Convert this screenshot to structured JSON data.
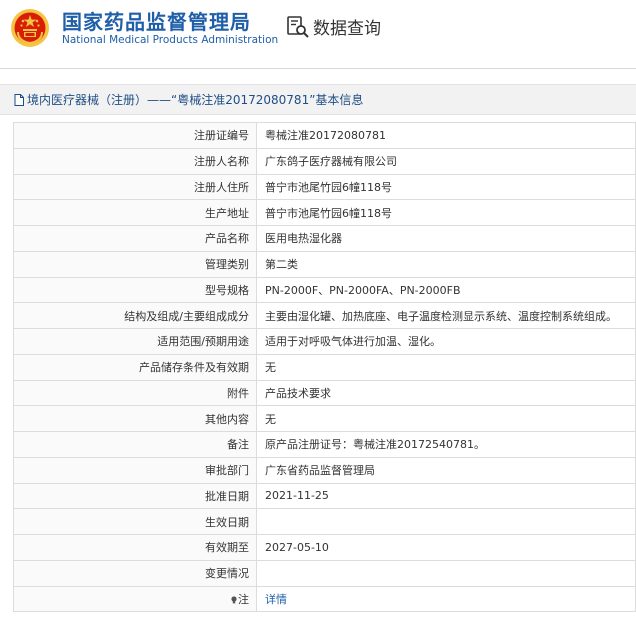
{
  "header": {
    "title_cn": "国家药品监督管理局",
    "title_en": "National Medical Products Administration",
    "query_label": "数据查询",
    "query_icon": "search-document-icon",
    "emblem_icon": "national-emblem-icon"
  },
  "breadcrumb": {
    "text": "境内医疗器械（注册）——“粤械注准20172080781”基本信息"
  },
  "rows": [
    {
      "label": "注册证编号",
      "value": "粤械注准20172080781"
    },
    {
      "label": "注册人名称",
      "value": "广东鸽子医疗器械有限公司"
    },
    {
      "label": "注册人住所",
      "value": "普宁市池尾竹园6幢118号"
    },
    {
      "label": "生产地址",
      "value": "普宁市池尾竹园6幢118号"
    },
    {
      "label": "产品名称",
      "value": "医用电热湿化器"
    },
    {
      "label": "管理类别",
      "value": "第二类"
    },
    {
      "label": "型号规格",
      "value": "PN-2000F、PN-2000FA、PN-2000FB"
    },
    {
      "label": "结构及组成/主要组成成分",
      "value": "主要由湿化罐、加热底座、电子温度检测显示系统、温度控制系统组成。"
    },
    {
      "label": "适用范围/预期用途",
      "value": "适用于对呼吸气体进行加温、湿化。"
    },
    {
      "label": "产品储存条件及有效期",
      "value": "无"
    },
    {
      "label": "附件",
      "value": "产品技术要求"
    },
    {
      "label": "其他内容",
      "value": "无"
    },
    {
      "label": "备注",
      "value": "原产品注册证号：粤械注准20172540781。"
    },
    {
      "label": "审批部门",
      "value": "广东省药品监督管理局"
    },
    {
      "label": "批准日期",
      "value": "2021-11-25"
    },
    {
      "label": "生效日期",
      "value": ""
    },
    {
      "label": "有效期至",
      "value": "2027-05-10"
    },
    {
      "label": "变更情况",
      "value": ""
    }
  ],
  "note": {
    "label": "注",
    "link_text": "详情",
    "icon": "lightbulb-icon"
  },
  "colors": {
    "brand_blue": "#1f5fa8",
    "crumb_text": "#1f4e86",
    "emblem_red": "#d81e06",
    "emblem_gold": "#f6c343"
  }
}
